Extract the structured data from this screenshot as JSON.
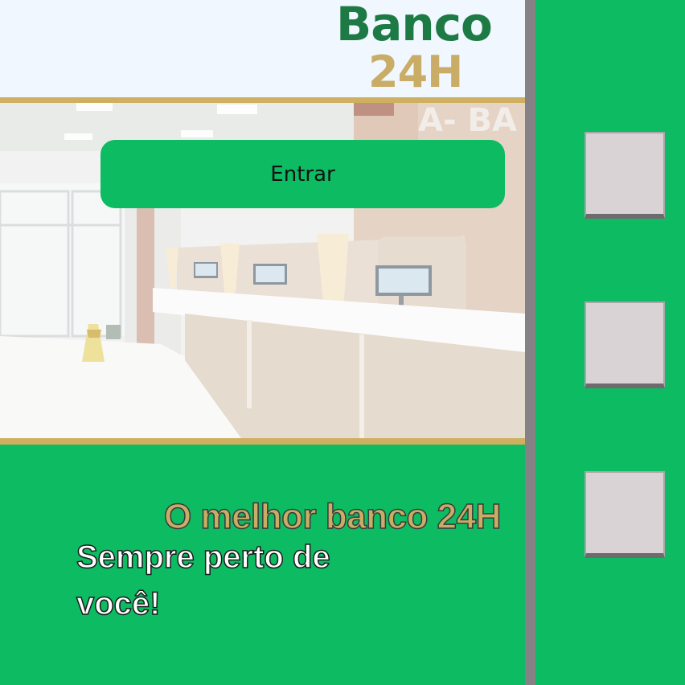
{
  "header": {
    "logo_line1": "Banco",
    "logo_line2": "24H"
  },
  "hero": {
    "enter_button_label": "Entrar"
  },
  "main": {
    "tagline": "O melhor banco 24H",
    "subline": "Sempre perto de você!"
  },
  "colors": {
    "primary_green": "#0cbb62",
    "logo_green": "#1e7a45",
    "gold": "#cfb060",
    "header_bg": "#f0f7fe",
    "divider": "#858185",
    "side_button": "#d9d3d6"
  }
}
